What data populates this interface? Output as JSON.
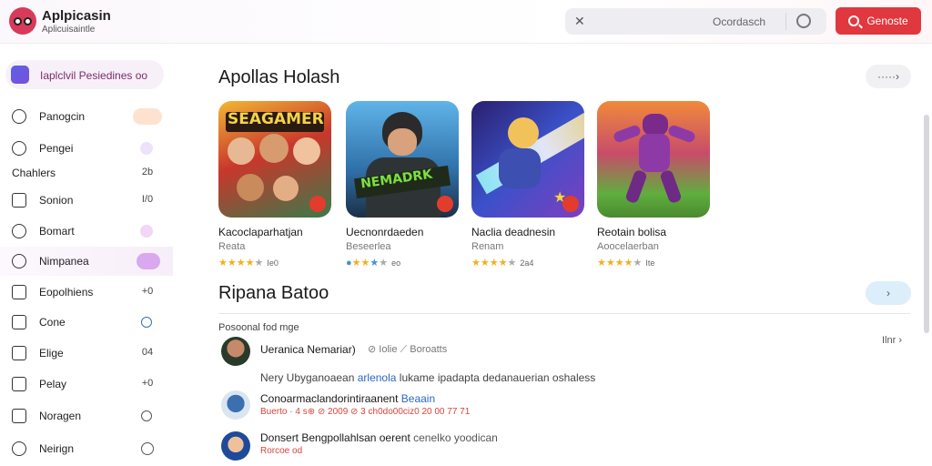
{
  "header": {
    "title": "Aplpicasin",
    "subtitle": "Aplicuisaintle",
    "search_placeholder": "Ocordasch",
    "primary_button_label": "Genoste"
  },
  "sidebar": {
    "header_label": "Iaplclvil Pesiedines oo",
    "items": [
      {
        "label": "Panogcin",
        "count": "",
        "icon": "circle-icon"
      },
      {
        "label": "Pengei",
        "count": "",
        "icon": "chat-icon"
      },
      {
        "label": "Chahlers",
        "count": "2b",
        "icon": ""
      },
      {
        "label": "Sonion",
        "count": "I/0",
        "icon": "image-icon"
      },
      {
        "label": "Bomart",
        "count": "",
        "icon": "chat-icon"
      },
      {
        "label": "Nimpanea",
        "count": "",
        "icon": "settings-icon"
      },
      {
        "label": "Eopolhiens",
        "count": "+0",
        "icon": "box-icon"
      },
      {
        "label": "Cone",
        "count": "",
        "icon": "list-icon"
      },
      {
        "label": "Elige",
        "count": "04",
        "icon": "file-icon"
      },
      {
        "label": "Pelay",
        "count": "+0",
        "icon": "list-icon"
      },
      {
        "label": "Noragen",
        "count": "",
        "icon": "image-icon"
      },
      {
        "label": "Neirign",
        "count": "",
        "icon": "alert-icon"
      }
    ]
  },
  "featured": {
    "title": "Apollas Holash",
    "more_label": "·····›",
    "apps": [
      {
        "name": "Kacoclaparhatjan",
        "developer": "Reata",
        "rating": "Ie0",
        "stars": 4,
        "art_text": "SEAGAMER"
      },
      {
        "name": "Uecnonrdaeden",
        "developer": "Beseerlea",
        "rating": "eo",
        "stars": 3,
        "art_text": "NEMADRK"
      },
      {
        "name": "Naclia deadnesin",
        "developer": "Renam",
        "rating": "2a4",
        "stars": 4,
        "art_text": ""
      },
      {
        "name": "Reotain bolisa",
        "developer": "Aoocelaerban",
        "rating": "Ite",
        "stars": 4,
        "art_text": ""
      }
    ]
  },
  "reviews": {
    "title": "Ripana Batoo",
    "more_label": "›",
    "subheading": "Posoonal fod mge",
    "see_all": "Ilnr ›",
    "items": [
      {
        "name": "Ueranica Nemariar)",
        "meta": "⊘ Iolie  ⟋ Boroatts",
        "body_prefix": "Nery  Ubyganoaean",
        "body_highlight": "arlenola",
        "body_suffix": "lukame ipadapta dedanauerian oshaless"
      },
      {
        "name": "Conoarmaclandorintiraanent",
        "name_highlight": "Beaain",
        "meta": "Buerto · 4 s⊕ ⊘ 2009 ⊘ 3 ch0do00ciz0 20 00 77 71"
      },
      {
        "name": "Donsert Bengpollahlsan oerent",
        "name_suffix": "cenelko yoodican",
        "meta": "Rorcoe od"
      }
    ]
  },
  "colors": {
    "accent": "#e0383e",
    "sidebar_active": "#f6eef8",
    "link": "#2a67c7"
  }
}
